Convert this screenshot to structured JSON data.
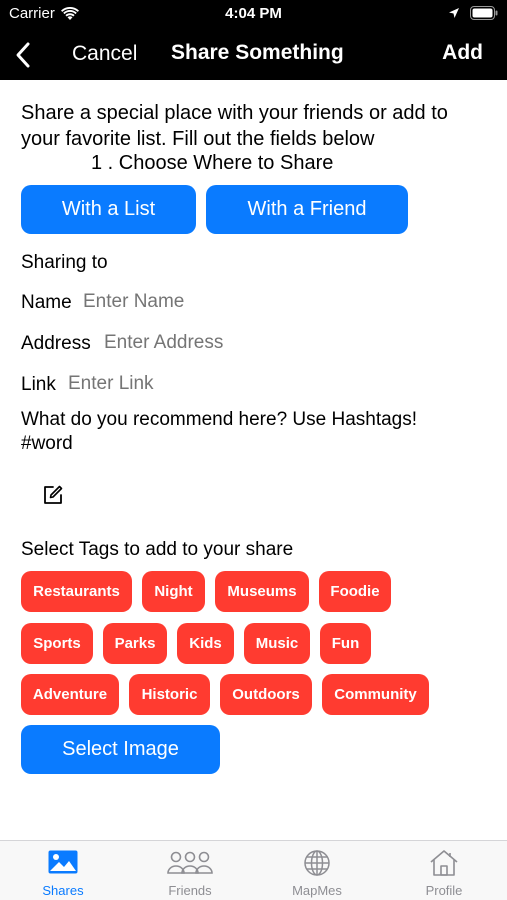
{
  "status": {
    "carrier": "Carrier",
    "time": "4:04 PM"
  },
  "nav": {
    "cancel": "Cancel",
    "title": "Share Something",
    "add": "Add"
  },
  "intro": "Share a special place with your friends or add to your favorite list. Fill out the fields below",
  "step": "1 . Choose Where to Share",
  "buttons": {
    "with_list": "With a List",
    "with_friend": "With a Friend",
    "select_image": "Select Image"
  },
  "form": {
    "sharing_to": "Sharing to",
    "name_label": "Name",
    "name_placeholder": "Enter Name",
    "address_label": "Address",
    "address_placeholder": "Enter Address",
    "link_label": "Link",
    "link_placeholder": "Enter Link",
    "recommend_line1": "What do you recommend here? Use Hashtags!",
    "recommend_line2": "#word"
  },
  "tags_title": "Select Tags to add to your share",
  "tags": [
    "Restaurants",
    "Night",
    "Museums",
    "Foodie",
    "Sports",
    "Parks",
    "Kids",
    "Music",
    "Fun",
    "Adventure",
    "Historic",
    "Outdoors",
    "Community"
  ],
  "tabs": [
    {
      "label": "Shares",
      "icon": "photo-icon",
      "active": true
    },
    {
      "label": "Friends",
      "icon": "people-icon",
      "active": false
    },
    {
      "label": "MapMes",
      "icon": "globe-icon",
      "active": false
    },
    {
      "label": "Profile",
      "icon": "house-icon",
      "active": false
    }
  ],
  "colors": {
    "accent": "#0a7bff",
    "tag": "#ff3b30",
    "bar": "#000000",
    "placeholder": "#c4c4c8"
  }
}
